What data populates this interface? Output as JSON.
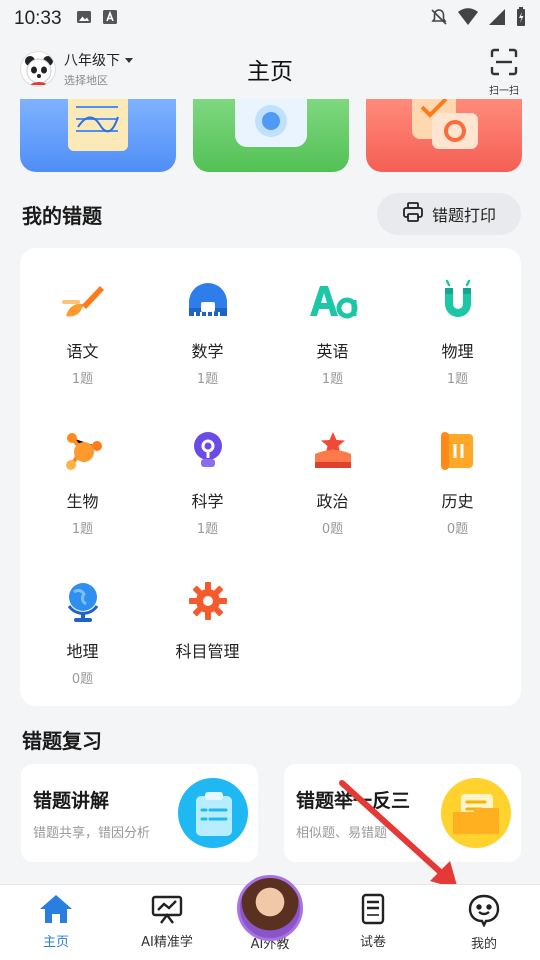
{
  "status_bar": {
    "time": "10:33"
  },
  "header": {
    "grade": "八年级下",
    "region": "选择地区",
    "title": "主页",
    "scan_label": "扫一扫"
  },
  "wrong_questions": {
    "title": "我的错题",
    "print_label": "错题打印",
    "subjects": [
      {
        "name": "语文",
        "count": "1题",
        "icon": "brush-icon"
      },
      {
        "name": "数学",
        "count": "1题",
        "icon": "ruler-icon"
      },
      {
        "name": "英语",
        "count": "1题",
        "icon": "aa-icon"
      },
      {
        "name": "物理",
        "count": "1题",
        "icon": "magnet-icon"
      },
      {
        "name": "生物",
        "count": "1题",
        "icon": "molecule-icon"
      },
      {
        "name": "科学",
        "count": "1题",
        "icon": "bulb-icon"
      },
      {
        "name": "政治",
        "count": "0题",
        "icon": "star-podium-icon"
      },
      {
        "name": "历史",
        "count": "0题",
        "icon": "scroll-icon"
      },
      {
        "name": "地理",
        "count": "0题",
        "icon": "globe-icon"
      },
      {
        "name": "科目管理",
        "count": "",
        "icon": "gear-icon"
      }
    ]
  },
  "review": {
    "title": "错题复习",
    "cards": [
      {
        "title": "错题讲解",
        "subtitle": "错题共享，错因分析"
      },
      {
        "title": "错题举一反三",
        "subtitle": "相似题、易错题"
      }
    ]
  },
  "bottom_nav": [
    {
      "label": "主页",
      "icon": "home-icon",
      "active": true
    },
    {
      "label": "AI精准学",
      "icon": "presentation-icon",
      "active": false
    },
    {
      "label": "AI外教",
      "icon": "ai-tutor-avatar",
      "active": false
    },
    {
      "label": "试卷",
      "icon": "test-paper-icon",
      "active": false
    },
    {
      "label": "我的",
      "icon": "smiley-icon",
      "active": false
    }
  ],
  "colors": {
    "accent": "#2a7de1",
    "orange": "#ff7a1a",
    "annotation_arrow": "#e53935"
  }
}
